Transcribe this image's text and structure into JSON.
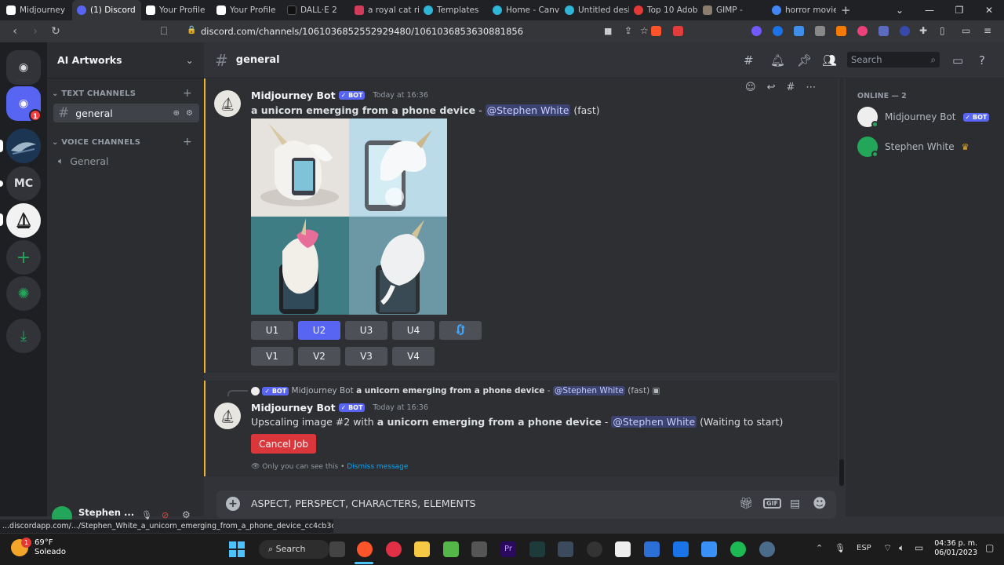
{
  "browser": {
    "tabs": [
      {
        "label": "Midjourney",
        "color": "#ffffff"
      },
      {
        "label": "(1) Discord",
        "color": "#5865f2"
      },
      {
        "label": "Your Profile",
        "color": "#ffffff"
      },
      {
        "label": "Your Profile",
        "color": "#ffffff"
      },
      {
        "label": "DALL·E 2",
        "color": "#111111"
      },
      {
        "label": "a royal cat ri",
        "color": "#d23c5a"
      },
      {
        "label": "Templates",
        "color": "#2fb6d6"
      },
      {
        "label": "Home - Canv",
        "color": "#2fb6d6"
      },
      {
        "label": "Untitled desi",
        "color": "#2fb6d6"
      },
      {
        "label": "Top 10 Adob",
        "color": "#e53935"
      },
      {
        "label": "GIMP - ",
        "color": "#8a7d6e"
      },
      {
        "label": "horror movie",
        "color": "#4285f4"
      }
    ],
    "url": "discord.com/channels/1061036852552929480/1061036853630881856",
    "status_url": "...discordapp.com/.../Stephen_White_a_unicorn_emerging_from_a_phone_device_cc4cb3cc-0..."
  },
  "servers": {
    "mc_label": "MC",
    "notification_count": "1"
  },
  "sidebar": {
    "server_name": "AI Artworks",
    "text_category": "TEXT CHANNELS",
    "text_channel": "general",
    "voice_category": "VOICE CHANNELS",
    "voice_channel": "General",
    "user_name": "Stephen ..."
  },
  "header": {
    "channel": "general",
    "search_placeholder": "Search"
  },
  "members": {
    "section": "ONLINE — 2",
    "list": [
      {
        "name": "Midjourney Bot",
        "badge": "✓ BOT"
      },
      {
        "name": "Stephen White",
        "crown": "♛"
      }
    ]
  },
  "message1": {
    "author": "Midjourney Bot",
    "badge": "✓ BOT",
    "time": "Today at 16:36",
    "prompt": "a unicorn emerging from a phone device",
    "sep": " - ",
    "mention": "@Stephen White",
    "speed": "(fast)",
    "upscale_buttons": [
      "U1",
      "U2",
      "U3",
      "U4"
    ],
    "variation_buttons": [
      "V1",
      "V2",
      "V3",
      "V4"
    ],
    "selected_button": "U2"
  },
  "message2": {
    "reply_author": "Midjourney Bot",
    "reply_badge": "✓ BOT",
    "reply_prompt": "a unicorn emerging from a phone device",
    "reply_sep": " - ",
    "reply_mention": "@Stephen White",
    "reply_speed": "(fast)",
    "author": "Midjourney Bot",
    "badge": "✓ BOT",
    "time": "Today at 16:36",
    "text_prefix": "Upscaling image #2 with ",
    "prompt": "a unicorn emerging from a phone device",
    "sep": " - ",
    "mention": "@Stephen White",
    "status": "(Waiting to start)",
    "cancel_label": "Cancel Job",
    "ephemeral_note": "Only you can see this • ",
    "dismiss_label": "Dismiss message"
  },
  "composer": {
    "text": "ASPECT, PERSPECT, CHARACTERS, ELEMENTS",
    "gif_label": "GIF"
  },
  "taskbar": {
    "weather_temp": "69°F",
    "weather_text": "Soleado",
    "weather_badge": "1",
    "search_label": "Search",
    "lang": "ESP",
    "time": "04:36 p. m.",
    "date": "06/01/2023"
  }
}
